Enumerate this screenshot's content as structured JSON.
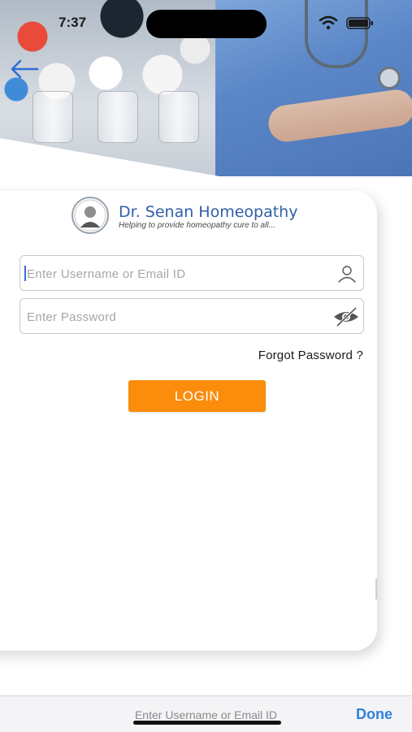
{
  "status_bar": {
    "time": "7:37"
  },
  "brand": {
    "name": "Dr. Senan Homeopathy",
    "tagline": "Helping to provide homeopathy cure to all..."
  },
  "form": {
    "username_placeholder": "Enter Username or Email ID",
    "username_value": "",
    "password_placeholder": "Enter Password",
    "password_value": "",
    "forgot_label": "Forgot Password ?",
    "login_label": "LOGIN"
  },
  "keyboard_accessory": {
    "field_label": "Enter Username or Email ID",
    "done_label": "Done"
  },
  "icons": {
    "back": "back-arrow-icon",
    "username": "user-icon",
    "password": "eye-slash-icon"
  },
  "colors": {
    "brand_blue": "#2f5fa8",
    "login_orange": "#fb8c0c",
    "done_blue": "#2f7fe0"
  }
}
